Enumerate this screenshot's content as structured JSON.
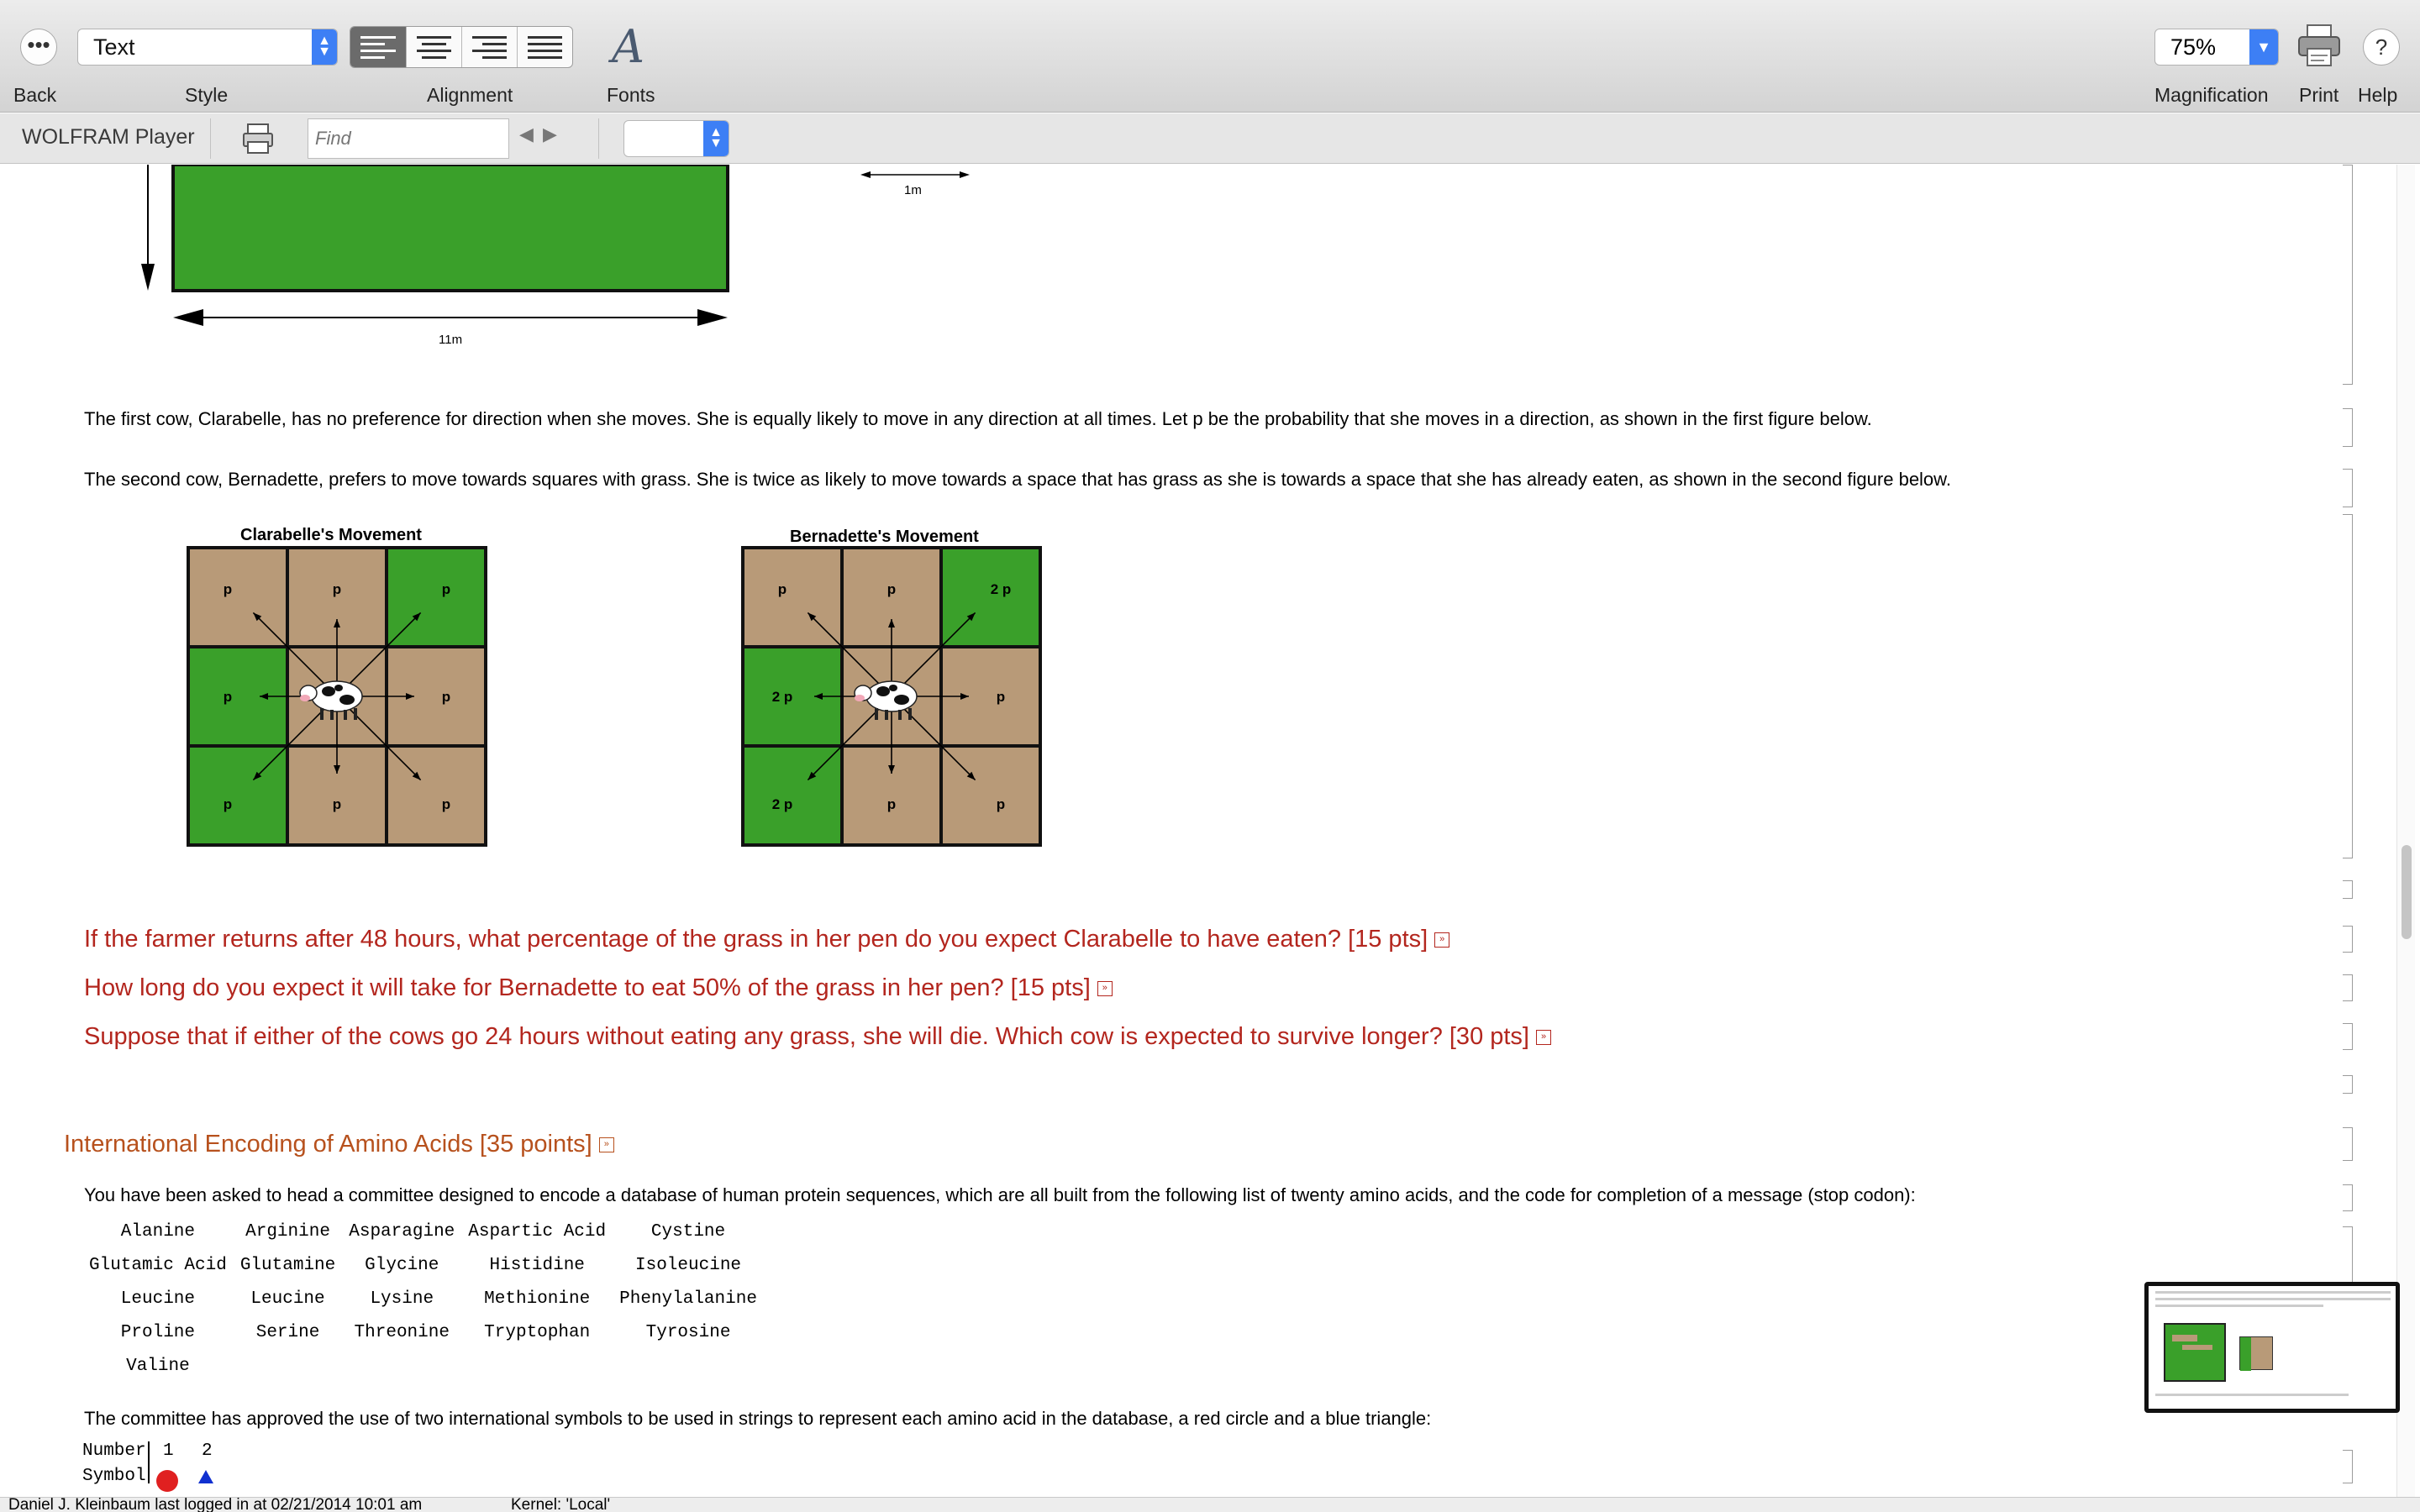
{
  "toolbar": {
    "back_label": "Back",
    "style_label": "Style",
    "style_value": "Text",
    "alignment_label": "Alignment",
    "fonts_label": "Fonts",
    "magnification_label": "Magnification",
    "magnification_value": "75%",
    "print_label": "Print",
    "help_label": "Help"
  },
  "playerbar": {
    "title": "WOLFRAM Player",
    "find_placeholder": "Find"
  },
  "figure_top": {
    "label_11m": "11m",
    "label_1m": "1m"
  },
  "paragraphs": {
    "clarabelle": "The first cow, Clarabelle, has no preference for direction when she moves.  She is equally likely to move in any direction at all times.  Let p be the probability that she moves in a direction, as shown in the first figure below.",
    "bernadette": "The second cow, Bernadette, prefers to move towards squares with grass.  She is twice as likely to move towards a space that has grass as she is towards a space that she has already eaten, as shown in the second figure below."
  },
  "grids": {
    "left_title": "Clarabelle's Movement",
    "right_title": "Bernadette's Movement",
    "left_cells": [
      "p",
      "p",
      "p",
      "p",
      "",
      "p",
      "p",
      "p",
      "p"
    ],
    "right_cells": [
      "p",
      "p",
      "2 p",
      "2 p",
      "",
      "p",
      "2 p",
      "p",
      "p"
    ],
    "left_green": [
      false,
      false,
      true,
      true,
      false,
      false,
      true,
      false,
      false
    ],
    "right_green": [
      false,
      false,
      true,
      true,
      false,
      false,
      true,
      false,
      false
    ],
    "colors": {
      "grass": "#3aa02a",
      "dirt": "#b89a78"
    }
  },
  "questions": [
    "If the farmer returns after 48 hours, what percentage of the grass in her pen do you expect Clarabelle to have eaten? [15 pts]",
    "How long do you expect it will take for Bernadette to eat 50% of the grass in her pen? [15 pts]",
    "Suppose that if either of the cows go 24 hours without eating any grass, she will die.  Which cow is expected to survive longer? [30 pts]"
  ],
  "section": {
    "title": "International Encoding of Amino Acids [35 points]",
    "intro": "You have been asked to head a committee designed to encode a database of human protein sequences, which are all built from the following list of twenty amino acids, and the code for completion of a message (stop codon):",
    "amino_rows": [
      [
        "Alanine",
        "Arginine",
        "Asparagine",
        "Aspartic Acid",
        "Cystine"
      ],
      [
        "Glutamic Acid",
        "Glutamine",
        "Glycine",
        "Histidine",
        "Isoleucine"
      ],
      [
        "Leucine",
        "Leucine",
        "Lysine",
        "Methionine",
        "Phenylalanine"
      ],
      [
        "Proline",
        "Serine",
        "Threonine",
        "Tryptophan",
        "Tyrosine"
      ],
      [
        "Valine",
        "",
        "",
        "",
        ""
      ]
    ],
    "symbols_text": "The committee has approved the use of two international symbols to be used in strings to represent each amino acid in the database, a red circle and a blue triangle:",
    "number_label": "Number",
    "symbol_label": "Symbol",
    "num_1": "1",
    "num_2": "2"
  },
  "status": {
    "login": "Daniel J. Kleinbaum last logged in at 02/21/2014 10:01 am",
    "kernel": "Kernel: 'Local'"
  }
}
